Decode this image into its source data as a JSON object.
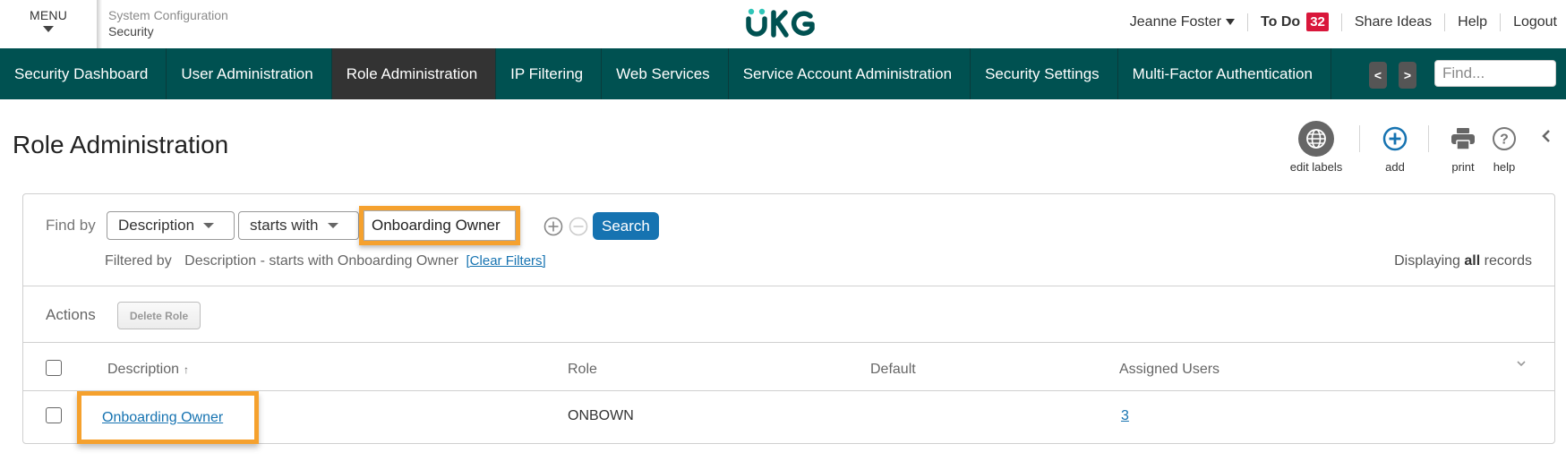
{
  "header": {
    "menu_label": "MENU",
    "breadcrumb_parent": "System Configuration",
    "breadcrumb_current": "Security",
    "logo_text": "UKG",
    "user_name": "Jeanne Foster",
    "todo_label": "To Do",
    "todo_count": "32",
    "share_ideas": "Share Ideas",
    "help": "Help",
    "logout": "Logout"
  },
  "nav": {
    "items": [
      {
        "label": "Security Dashboard",
        "active": false
      },
      {
        "label": "User Administration",
        "active": false
      },
      {
        "label": "Role Administration",
        "active": true
      },
      {
        "label": "IP Filtering",
        "active": false
      },
      {
        "label": "Web Services",
        "active": false
      },
      {
        "label": "Service Account Administration",
        "active": false
      },
      {
        "label": "Security Settings",
        "active": false
      },
      {
        "label": "Multi-Factor Authentication",
        "active": false
      }
    ],
    "prev_label": "<",
    "next_label": ">",
    "find_placeholder": "Find..."
  },
  "page": {
    "title": "Role Administration",
    "tools": {
      "edit_labels": "edit labels",
      "add": "add",
      "print": "print",
      "help": "help"
    }
  },
  "search": {
    "find_by_label": "Find by",
    "field_selected": "Description",
    "operator_selected": "starts with",
    "value": "Onboarding Owner",
    "search_button": "Search",
    "filtered_by_label": "Filtered by",
    "filter_text": "Description - starts with Onboarding Owner",
    "clear_filters": "[Clear Filters]",
    "displaying_prefix": "Displaying",
    "displaying_bold": "all",
    "displaying_suffix": "records"
  },
  "actions": {
    "label": "Actions",
    "delete_role": "Delete Role"
  },
  "table": {
    "columns": [
      "Description",
      "Role",
      "Default",
      "Assigned Users"
    ],
    "sort_indicator": "↑",
    "rows": [
      {
        "description": "Onboarding Owner",
        "role": "ONBOWN",
        "default": "",
        "assigned_users": "3"
      }
    ]
  },
  "colors": {
    "brand_teal": "#005151",
    "active_tab": "#333333",
    "highlight_orange": "#f5a12e",
    "link_blue": "#1673b1",
    "badge_red": "#d9173b"
  }
}
